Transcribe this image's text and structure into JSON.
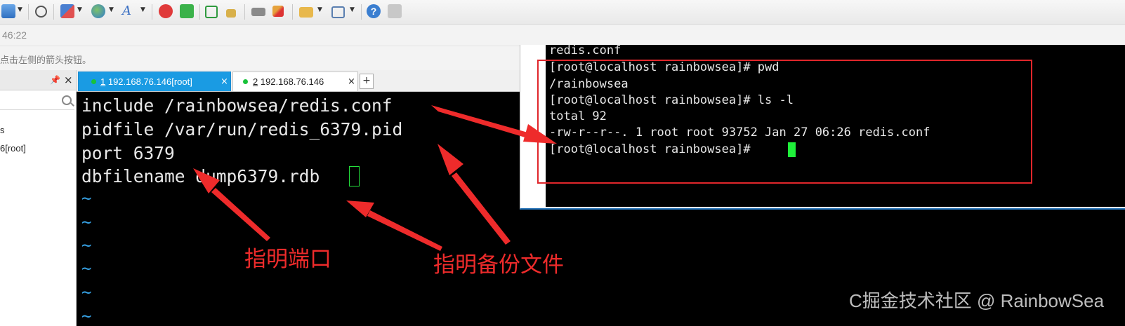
{
  "toolbar": {
    "icons": [
      "new-session-icon",
      "search-icon",
      "layout-icon",
      "globe-icon",
      "font-icon",
      "red-swirl-icon",
      "green-transfer-icon",
      "fullscreen-icon",
      "lock-icon",
      "keyboard-icon",
      "highlighter-icon",
      "folder-add-icon",
      "window-layout-icon",
      "help-icon",
      "chat-icon"
    ]
  },
  "status": {
    "time": "46:22",
    "hint": "点击左侧的箭头按钮。"
  },
  "left_panel": {
    "item1": "s",
    "item2": "6[root]"
  },
  "tabs": [
    {
      "num": "1",
      "label": " 192.168.76.146[root]",
      "active": true
    },
    {
      "num": "2",
      "label": " 192.168.76.146",
      "active": false
    }
  ],
  "tab_add": "+",
  "tab_close": "×",
  "terminal": {
    "lines": [
      "include /rainbowsea/redis.conf",
      "pidfile /var/run/redis_6379.pid",
      "port 6379",
      "dbfilename dump6379.rdb"
    ],
    "tilde": "~"
  },
  "overlay_terminal": {
    "lines": [
      "redis.conf",
      "[root@localhost rainbowsea]# pwd",
      "/rainbowsea",
      "[root@localhost rainbowsea]# ls -l",
      "total 92",
      "-rw-r--r--. 1 root root 93752 Jan 27 06:26 redis.conf",
      "[root@localhost rainbowsea]# "
    ]
  },
  "annotations": {
    "port_note": "指明端口",
    "backup_note": "指明备份文件"
  },
  "watermark": "C掘金技术社区 @ RainbowSea",
  "colors": {
    "annotation": "#ee2b2b",
    "tab_active": "#1a9be3",
    "cursor": "#1ff03a",
    "tilde": "#37a3e6"
  }
}
